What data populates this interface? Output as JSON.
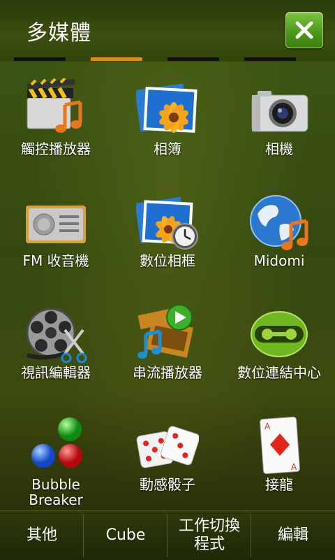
{
  "header": {
    "title": "多媒體",
    "close_icon": "close-icon",
    "accent_color": "#d98c1e"
  },
  "pages": {
    "count": 4,
    "active_index": 1
  },
  "apps": [
    {
      "label": "觸控播放器",
      "icon": "music-player-icon"
    },
    {
      "label": "相簿",
      "icon": "photo-album-icon"
    },
    {
      "label": "相機",
      "icon": "camera-icon"
    },
    {
      "label": "FM 收音機",
      "icon": "fm-radio-icon"
    },
    {
      "label": "數位相框",
      "icon": "digital-frame-icon"
    },
    {
      "label": "Midomi",
      "icon": "midomi-icon"
    },
    {
      "label": "視訊編輯器",
      "icon": "video-editor-icon"
    },
    {
      "label": "串流播放器",
      "icon": "streaming-player-icon"
    },
    {
      "label": "數位連結中心",
      "icon": "digital-link-icon"
    },
    {
      "label": "Bubble\nBreaker",
      "icon": "bubble-breaker-icon"
    },
    {
      "label": "動感骰子",
      "icon": "dice-icon"
    },
    {
      "label": "接龍",
      "icon": "solitaire-icon"
    }
  ],
  "softkeys": {
    "other": "其他",
    "cube": "Cube",
    "task_switcher": "工作切換\n程式",
    "edit": "編輯"
  }
}
